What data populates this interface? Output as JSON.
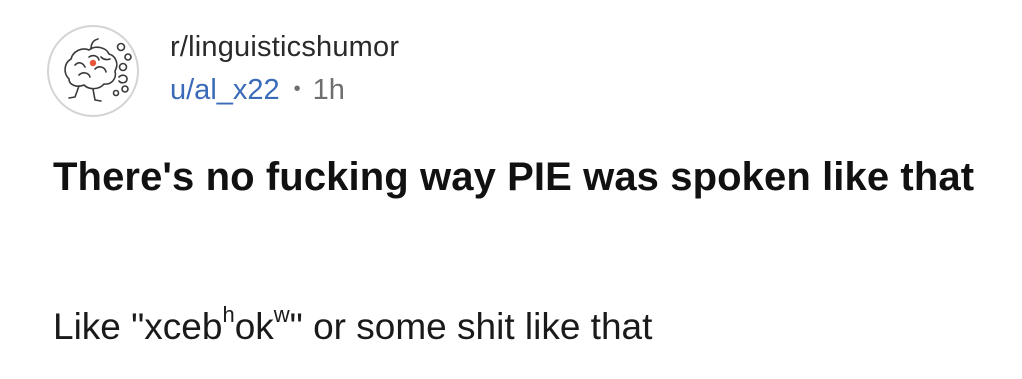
{
  "post": {
    "subreddit": "r/linguisticshumor",
    "username": "u/al_x22",
    "separator": "•",
    "time": "1h",
    "title": "There's no fucking way PIE was spoken like that",
    "body": {
      "prefix": "Like \"xceb",
      "sup1": "h",
      "middle": "ok",
      "sup2": "w",
      "suffix": "\" or some shit like that"
    },
    "avatar_icon": "brain-doodle-icon"
  },
  "colors": {
    "username": "#3a6bb8",
    "meta_gray": "#6f6f6f",
    "text": "#111111",
    "avatar_accent": "#e8553a"
  }
}
